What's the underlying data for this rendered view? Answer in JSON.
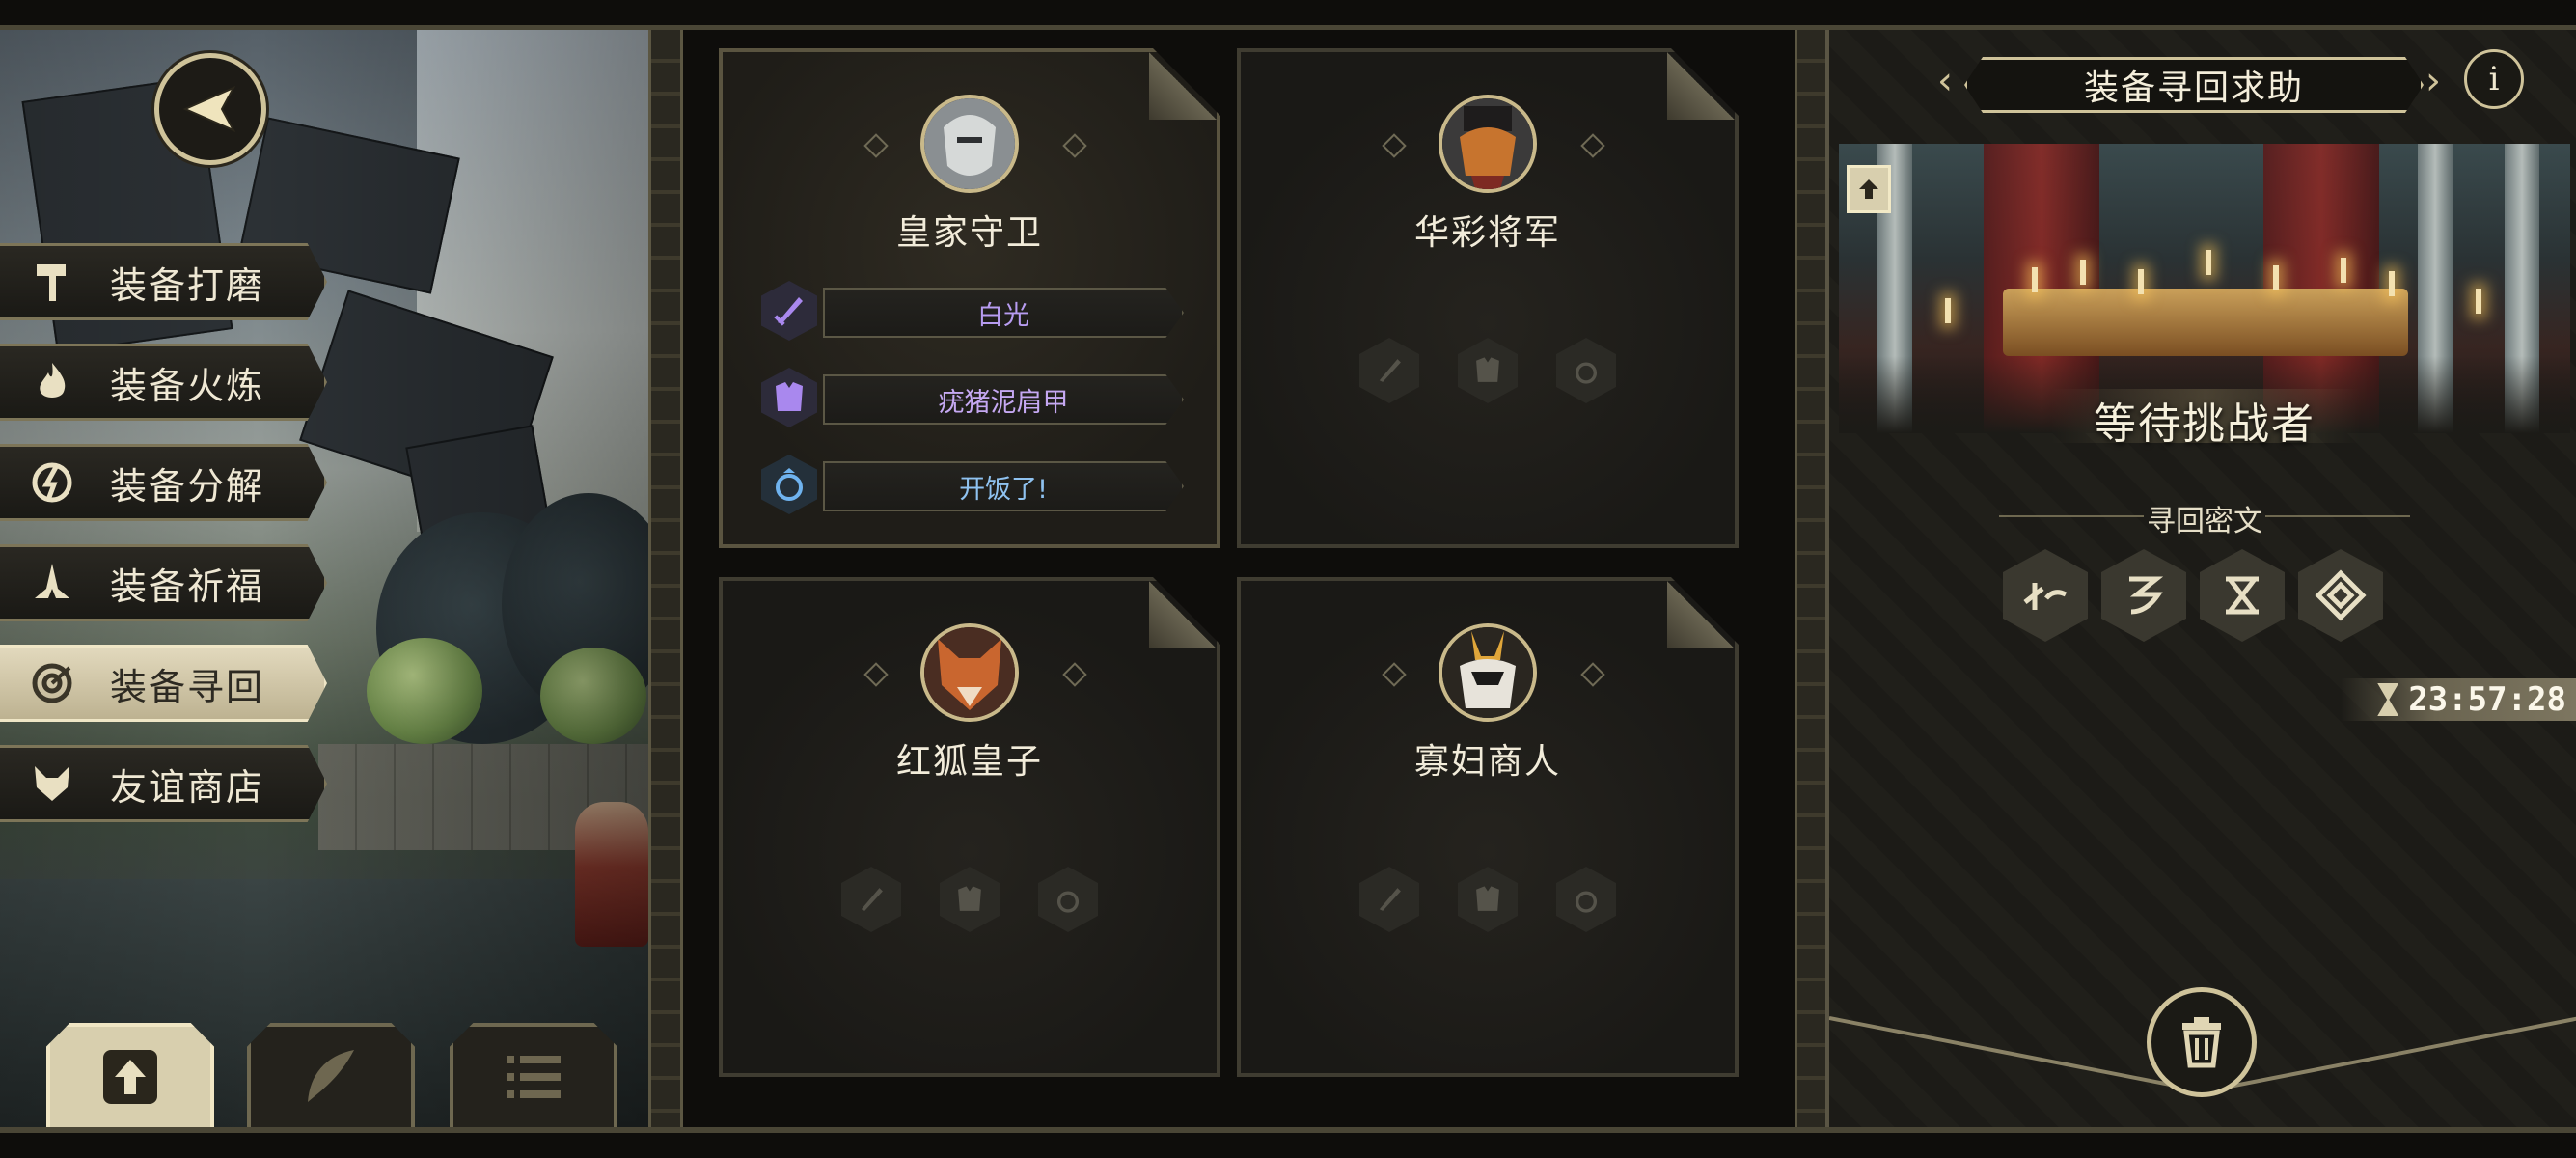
{
  "nav": {
    "back_icon": "arrow-left-icon",
    "menu": [
      {
        "label": "装备打磨",
        "icon": "hammer-icon",
        "active": false
      },
      {
        "label": "装备火炼",
        "icon": "flame-icon",
        "active": false
      },
      {
        "label": "装备分解",
        "icon": "disassemble-icon",
        "active": false
      },
      {
        "label": "装备祈福",
        "icon": "pray-icon",
        "active": false
      },
      {
        "label": "装备寻回",
        "icon": "target-icon",
        "active": true
      },
      {
        "label": "友谊商店",
        "icon": "fox-icon",
        "active": false
      }
    ],
    "bottom_buttons": [
      {
        "icon": "upload-icon",
        "active": true
      },
      {
        "icon": "feather-icon",
        "active": false
      },
      {
        "icon": "list-icon",
        "active": false
      }
    ]
  },
  "characters": [
    {
      "name": "皇家守卫",
      "selected": true,
      "equipment": [
        {
          "type": "weapon",
          "icon": "sword-icon",
          "name": "白光",
          "color": "#b79cf0"
        },
        {
          "type": "armor",
          "icon": "armor-icon",
          "name": "疣猪泥肩甲",
          "color": "#c5a8f2"
        },
        {
          "type": "ring",
          "icon": "ring-icon",
          "name": "开饭了!",
          "color": "#8fc2f0"
        }
      ]
    },
    {
      "name": "华彩将军",
      "selected": false,
      "equipment": []
    },
    {
      "name": "红狐皇子",
      "selected": false,
      "equipment": []
    },
    {
      "name": "寡妇商人",
      "selected": false,
      "equipment": []
    }
  ],
  "retrieval": {
    "title": "装备寻回求助",
    "info_icon": "info-icon",
    "status": "等待挑战者",
    "rune_section_title": "寻回密文",
    "runes": [
      "rune-1-icon",
      "rune-2-icon",
      "rune-3-icon",
      "rune-4-icon"
    ],
    "timer": "23:57:28",
    "trash_icon": "trash-icon"
  },
  "colors": {
    "accent": "#cfc39a",
    "panel": "#1c1b17"
  }
}
